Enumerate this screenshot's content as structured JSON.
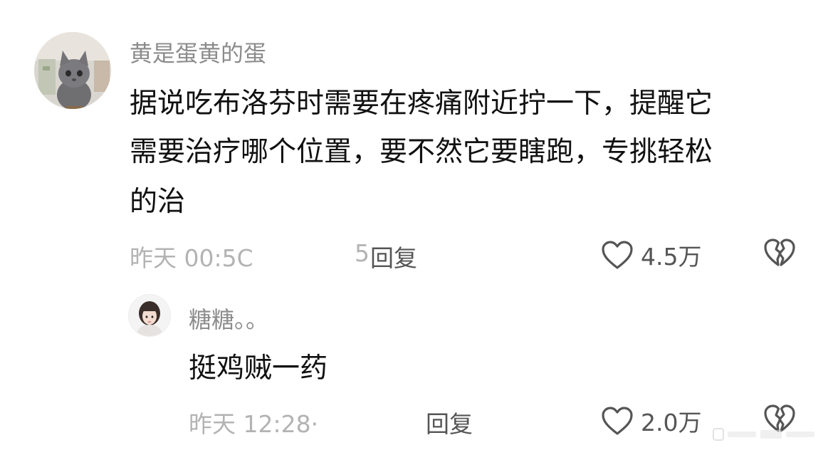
{
  "comments": [
    {
      "username": "黄是蛋黄的蛋",
      "lines": [
        "据说吃布洛芬时需要在疼痛附近拧一下，提醒它",
        "需要治疗哪个位置，要不然它要瞎跑，专挑轻松",
        "的治"
      ],
      "time": "昨天 00:5C",
      "time_fragment": "5",
      "reply_label": "回复",
      "likes": "4.5万",
      "avatar_icon": "kitten-avatar"
    },
    {
      "username": "糖糖。。",
      "lines": [
        "挺鸡贼一药"
      ],
      "time": "昨天 12:28·",
      "reply_label": "回复",
      "likes": "2.0万",
      "avatar_icon": "girl-avatar"
    }
  ],
  "icons": {
    "like": "heart-outline-icon",
    "dislike": "broken-heart-icon"
  },
  "colors": {
    "username": "#8c8c8c",
    "meta": "#b3b3b3",
    "text": "#111111",
    "action": "#555555"
  }
}
